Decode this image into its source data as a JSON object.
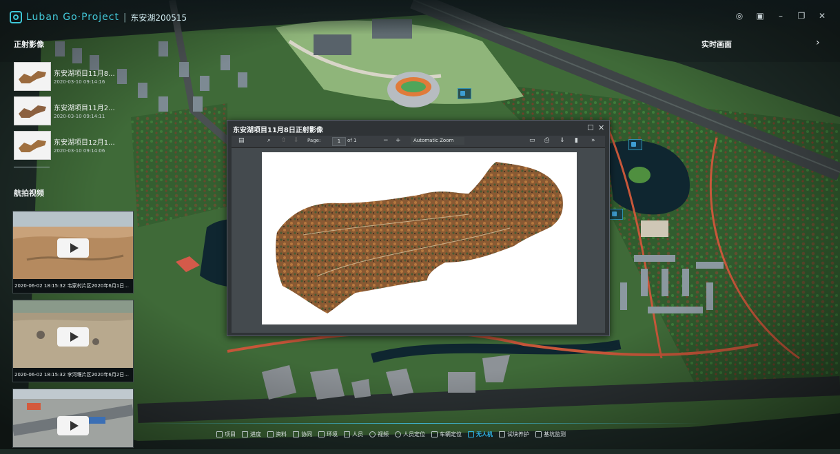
{
  "app": {
    "name": "Luban Go·Project",
    "separator": "|",
    "project": "东安湖200515"
  },
  "window_controls": [
    "settings-icon",
    "tile-icon",
    "minimize-icon",
    "maximize-icon",
    "close-icon"
  ],
  "sidebar": {
    "ortho_title": "正射影像",
    "ortho_items": [
      {
        "name": "东安湖项目11月8...",
        "date": "2020-03-10 09:14:16"
      },
      {
        "name": "东安湖项目11月2...",
        "date": "2020-03-10 09:14:11"
      },
      {
        "name": "东安湖项目12月1...",
        "date": "2020-03-10 09:14:06"
      }
    ],
    "video_title": "航拍视频",
    "videos": [
      {
        "caption": "2020-06-02 18:15:32 韦家村片区2020年6月1日..."
      },
      {
        "caption": "2020-06-02 18:15:32 李河堰片区2020年6月2日..."
      },
      {
        "caption": ""
      }
    ]
  },
  "realtime": {
    "title": "实时画面",
    "arrow": "›"
  },
  "dialog": {
    "title": "东安湖项目11月8日正射影像",
    "toolbar": {
      "page_label": "Page:",
      "page_value": "1",
      "page_total": "of 1",
      "zoom": "Automatic Zoom",
      "more": "»"
    }
  },
  "bottom_nav": [
    {
      "label": "项目",
      "active": false
    },
    {
      "label": "进度",
      "active": false
    },
    {
      "label": "资料",
      "active": false
    },
    {
      "label": "协同",
      "active": false
    },
    {
      "label": "环境",
      "active": false
    },
    {
      "label": "人员",
      "active": false
    },
    {
      "label": "视频",
      "active": false
    },
    {
      "label": "人员定位",
      "active": false
    },
    {
      "label": "车辆定位",
      "active": false
    },
    {
      "label": "无人机",
      "active": true
    },
    {
      "label": "试块养护",
      "active": false
    },
    {
      "label": "基坑监测",
      "active": false
    }
  ],
  "colors": {
    "accent": "#2fb6e8",
    "brand": "#43c9da",
    "map_green": "#3f6a38"
  }
}
